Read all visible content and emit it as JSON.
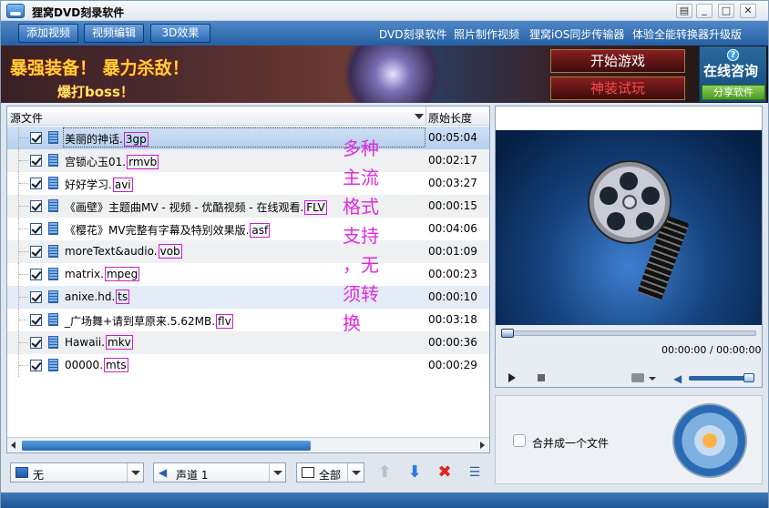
{
  "window": {
    "title": "狸窝DVD刻录软件",
    "minimize": "▣",
    "restore": "□",
    "close": "✕",
    "extra": "▤"
  },
  "toolbar": {
    "add_video": "添加视频",
    "edit_video": "视频编辑",
    "effect_3d": "3D效果",
    "links": [
      "DVD刻录软件",
      "照片制作视频",
      "狸窝iOS同步传输器",
      "体验全能转换器升级版"
    ]
  },
  "banner": {
    "slogan1": "暴强装备！ 暴力杀敌！",
    "slogan2": "爆打boss！",
    "start_game": "开始游戏",
    "equip_trial": "神装试玩",
    "consult": "在线咨询",
    "share": "分享软件",
    "help": "?"
  },
  "list": {
    "col_source": "源文件",
    "col_duration": "原始长度",
    "rows": [
      {
        "name": "美丽的神话",
        "ext": "3gp",
        "duration": "00:05:04"
      },
      {
        "name": "宫锁心玉01",
        "ext": "rmvb",
        "duration": "00:02:17"
      },
      {
        "name": "好好学习",
        "ext": "avi",
        "duration": "00:03:27"
      },
      {
        "name": "《画壁》主题曲MV - 视频 - 优酷视频 - 在线观看",
        "ext": "FLV",
        "duration": "00:00:15"
      },
      {
        "name": "《樱花》MV完整有字幕及特别效果版",
        "ext": "asf",
        "duration": "00:04:06"
      },
      {
        "name": "moreText&audio",
        "ext": "vob",
        "duration": "00:01:09"
      },
      {
        "name": "matrix",
        "ext": "mpeg",
        "duration": "00:00:23"
      },
      {
        "name": "anixe.hd",
        "ext": "ts",
        "duration": "00:00:10"
      },
      {
        "name": "_广场舞+请到草原来.5.62MB",
        "ext": "flv",
        "duration": "00:03:18"
      },
      {
        "name": "Hawaii",
        "ext": "mkv",
        "duration": "00:00:36"
      },
      {
        "name": "00000",
        "ext": "mts",
        "duration": "00:00:29"
      }
    ],
    "annotation": [
      "多种",
      "主流",
      "格式",
      "支持",
      "，无",
      "须转",
      "换"
    ]
  },
  "controls": {
    "subtitle": "无",
    "audio_track": "声道 1",
    "scope": "全部"
  },
  "player": {
    "time": "00:00:00 / 00:00:00",
    "progress": 0,
    "volume": 1.0
  },
  "burn": {
    "merge_label": "合并成一个文件",
    "merge_checked": false
  }
}
